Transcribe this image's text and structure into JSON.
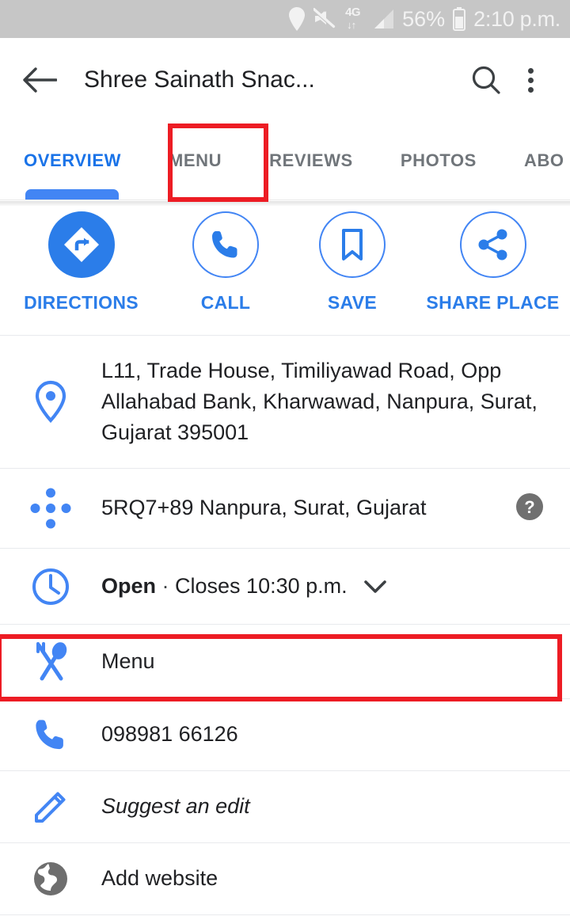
{
  "status_bar": {
    "battery_percent": "56%",
    "time": "2:10 p.m.",
    "network_label": "4G",
    "icons": [
      "location-icon",
      "volume-mute-icon",
      "4g-data-icon",
      "signal-bars-icon",
      "battery-icon"
    ]
  },
  "app_bar": {
    "title": "Shree Sainath Snac...",
    "back_icon": "back-arrow-icon",
    "search_icon": "search-icon",
    "overflow_icon": "overflow-menu-icon"
  },
  "tabs": {
    "items": [
      {
        "label": "OVERVIEW",
        "active": true
      },
      {
        "label": "MENU",
        "active": false
      },
      {
        "label": "REVIEWS",
        "active": false
      },
      {
        "label": "PHOTOS",
        "active": false
      },
      {
        "label": "ABO",
        "active": false
      }
    ],
    "active_color": "#1a73e8",
    "inactive_color": "#70757a"
  },
  "actions": [
    {
      "label": "DIRECTIONS",
      "icon": "directions-icon",
      "filled": true
    },
    {
      "label": "CALL",
      "icon": "phone-icon",
      "filled": false
    },
    {
      "label": "SAVE",
      "icon": "bookmark-icon",
      "filled": false
    },
    {
      "label": "SHARE PLACE",
      "icon": "share-icon",
      "filled": false
    }
  ],
  "info": {
    "address": {
      "icon": "place-pin-icon",
      "text": "L11, Trade House, Timiliyawad Road, Opp Allahabad Bank, Kharwawad, Nanpura, Surat, Gujarat 395001"
    },
    "plus_code": {
      "icon": "plus-code-icon",
      "text": "5RQ7+89 Nanpura, Surat, Gujarat",
      "help_icon": "help-icon"
    },
    "hours": {
      "icon": "clock-icon",
      "status": "Open",
      "separator": " · ",
      "detail": "Closes 10:30 p.m.",
      "chevron_icon": "chevron-down-icon"
    },
    "menu": {
      "icon": "restaurant-menu-icon",
      "text": "Menu"
    },
    "phone": {
      "icon": "phone-icon",
      "text": "098981 66126"
    },
    "suggest_edit": {
      "icon": "pencil-icon",
      "text": "Suggest an edit"
    },
    "website": {
      "icon": "globe-icon",
      "text": "Add website"
    }
  },
  "annotations": {
    "color": "#ed1c24",
    "boxes": [
      "menu-tab",
      "menu-row"
    ]
  },
  "colors": {
    "brand_blue": "#2b7de9",
    "tab_blue": "#1a73e8",
    "text_primary": "#202124",
    "text_muted": "#80868b",
    "status_bar_bg": "#c6c6c6",
    "annotation_red": "#ed1c24"
  }
}
